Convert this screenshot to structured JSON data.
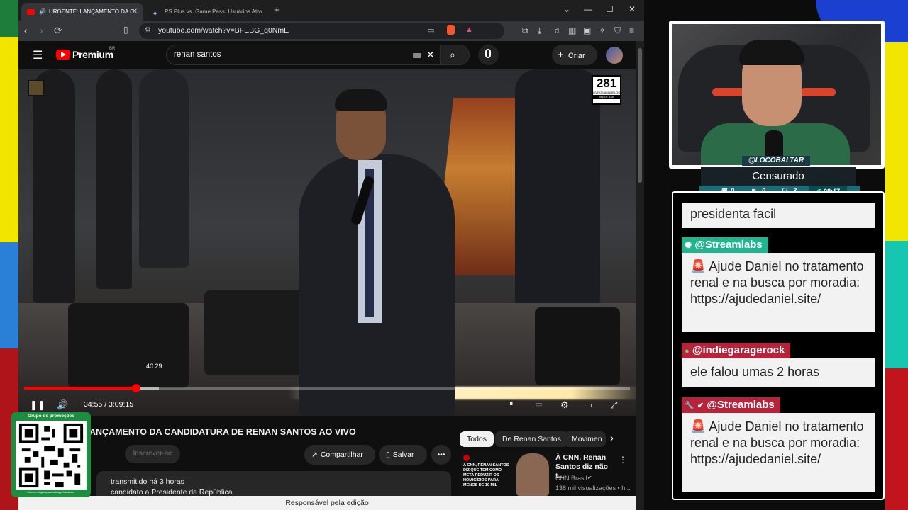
{
  "colors": {
    "yt_red": "#ff0000",
    "chat_tag_streamlabs_1": "#1fb58f",
    "chat_tag_other": "#b8233c"
  },
  "browser": {
    "tabs": [
      {
        "title": "URGENTE: LANÇAMENTO DA CANDIDATURA",
        "active": true
      },
      {
        "title": "PS Plus vs. Game Pass: Usuários Ativos - Gem",
        "active": false
      }
    ],
    "url": "youtube.com/watch?v=BFEBG_q0NmE"
  },
  "youtube": {
    "brand": "Premium",
    "region": "BR",
    "search_value": "renan santos",
    "create_label": "Criar",
    "player": {
      "hover_time": "40:29",
      "current_time": "34:55",
      "duration": "3:09:15",
      "played_fraction": 0.185,
      "counter_number": "281",
      "counter_caption": "LIVROS AMARELOS",
      "counter_goal": "META: 428"
    },
    "video_title": "ANÇAMENTO DA CANDIDATURA DE RENAN SANTOS AO VIVO",
    "subscribe_label": "Inscrever-se",
    "share_label": "Compartilhar",
    "save_label": "Salvar",
    "description": {
      "line1": "transmitido há 3 horas",
      "line2": "candidato a Presidente da República"
    },
    "chips": [
      "Todos",
      "De Renan Santos",
      "Movimen"
    ],
    "recommendation": {
      "thumb_text": "À CNN, RENAN SANTOS DIZ QUE TEM COMO META REDUZIR OS HOMICÍDIOS PARA MENOS DE 10 MIL",
      "title": "À CNN, Renan Santos diz não t...",
      "channel": "CNN Brasil",
      "views": "138 mil visualizações • h..."
    },
    "status_text": "Responsável pela edição"
  },
  "qr": {
    "header": "Grupo de promoções",
    "footer": "itstore.net/groups/whatsapp/hardware"
  },
  "stream": {
    "handle": "@LOCOBALTAR",
    "status": "Censurado",
    "stats": {
      "a": "0",
      "b": "0",
      "c": "3",
      "time": "08:17"
    }
  },
  "chat": {
    "messages": [
      {
        "user": "",
        "text": "presidenta facil"
      },
      {
        "user": "@Streamlabs",
        "text": "🚨 Ajude Daniel no tratamento renal e na busca por moradia: https://ajudedaniel.site/"
      },
      {
        "user": "@indiegaragerock",
        "text": "ele falou umas 2 horas"
      },
      {
        "user": "@Streamlabs",
        "text": "🚨 Ajude Daniel no tratamento renal e na busca por moradia: https://ajudedaniel.site/"
      }
    ]
  }
}
